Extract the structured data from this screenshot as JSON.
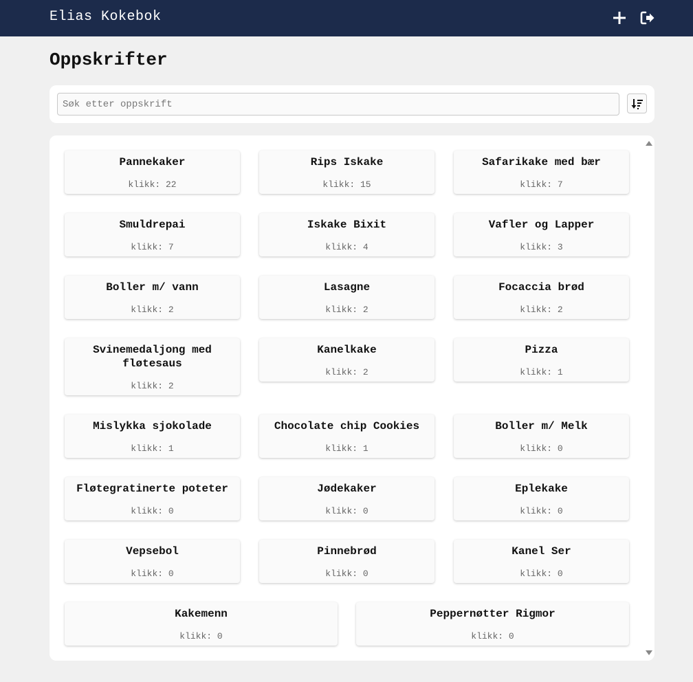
{
  "app": {
    "title": "Elias Kokebok",
    "icons": {
      "add": "plus-icon",
      "logout": "sign-out-icon",
      "sort": "sort-descending-icon"
    }
  },
  "colors": {
    "navbar": "#1c2b4b",
    "background": "#f0f0f0",
    "panel": "#ffffff",
    "card": "#fafafa"
  },
  "page": {
    "title": "Oppskrifter"
  },
  "search": {
    "placeholder": "Søk etter oppskrift",
    "value": ""
  },
  "clicks_prefix": "klikk:",
  "recipes": [
    {
      "name": "Pannekaker",
      "clicks": "klikk: 22"
    },
    {
      "name": "Rips Iskake",
      "clicks": "klikk: 15"
    },
    {
      "name": "Safarikake med bær",
      "clicks": "klikk: 7"
    },
    {
      "name": "Smuldrepai",
      "clicks": "klikk: 7"
    },
    {
      "name": "Iskake Bixit",
      "clicks": "klikk: 4"
    },
    {
      "name": "Vafler og Lapper",
      "clicks": "klikk: 3"
    },
    {
      "name": "Boller m/ vann",
      "clicks": "klikk: 2"
    },
    {
      "name": "Lasagne",
      "clicks": "klikk: 2"
    },
    {
      "name": "Focaccia brød",
      "clicks": "klikk: 2"
    },
    {
      "name": "Svinemedaljong med fløtesaus",
      "clicks": "klikk: 2"
    },
    {
      "name": "Kanelkake",
      "clicks": "klikk: 2"
    },
    {
      "name": "Pizza",
      "clicks": "klikk: 1"
    },
    {
      "name": "Mislykka sjokolade",
      "clicks": "klikk: 1"
    },
    {
      "name": "Chocolate chip Cookies",
      "clicks": "klikk: 1"
    },
    {
      "name": "Boller m/ Melk",
      "clicks": "klikk: 0"
    },
    {
      "name": "Fløtegratinerte poteter",
      "clicks": "klikk: 0"
    },
    {
      "name": "Jødekaker",
      "clicks": "klikk: 0"
    },
    {
      "name": "Eplekake",
      "clicks": "klikk: 0"
    },
    {
      "name": "Vepsebol",
      "clicks": "klikk: 0"
    },
    {
      "name": "Pinnebrød",
      "clicks": "klikk: 0"
    },
    {
      "name": "Kanel Ser",
      "clicks": "klikk: 0"
    },
    {
      "name": "Kakemenn",
      "clicks": "klikk: 0"
    },
    {
      "name": "Peppernøtter Rigmor",
      "clicks": "klikk: 0"
    }
  ]
}
